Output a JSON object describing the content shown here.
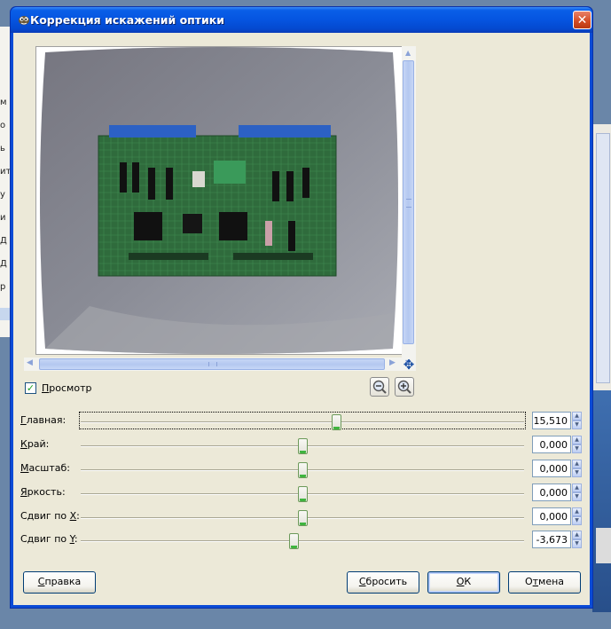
{
  "window": {
    "title": "Коррекция искажений оптики",
    "close_glyph": "✕"
  },
  "background": {
    "left_items": [
      "м",
      "о",
      "ь",
      "ит",
      "у",
      "и",
      "Д",
      "Д",
      "р"
    ]
  },
  "preview": {
    "checkbox_checked": true,
    "checkbox_mark": "✓",
    "checkbox_label_first": "П",
    "checkbox_label_rest": "росмотр",
    "nav_glyph": "✥"
  },
  "sliders": [
    {
      "label_pre": "",
      "label_ul": "Г",
      "label_post": "лавная:",
      "value": "15,510",
      "value_num": 15.51,
      "focused": true
    },
    {
      "label_pre": "",
      "label_ul": "К",
      "label_post": "рай:",
      "value": "0,000",
      "value_num": 0.0
    },
    {
      "label_pre": "",
      "label_ul": "М",
      "label_post": "асштаб:",
      "value": "0,000",
      "value_num": 0.0
    },
    {
      "label_pre": "",
      "label_ul": "Я",
      "label_post": "ркость:",
      "value": "0,000",
      "value_num": 0.0
    },
    {
      "label_pre": "Сдвиг по ",
      "label_ul": "X",
      "label_post": ":",
      "value": "0,000",
      "value_num": 0.0
    },
    {
      "label_pre": "Сдвиг по ",
      "label_ul": "Y",
      "label_post": ":",
      "value": "-3,673",
      "value_num": -3.673
    }
  ],
  "slider_range": [
    -100,
    100
  ],
  "spin_up": "▲",
  "spin_down": "▼",
  "buttons": {
    "help": {
      "ul": "С",
      "rest": "правка"
    },
    "reset": {
      "ul": "С",
      "rest": "бросить"
    },
    "ok": {
      "ul": "О",
      "rest": "К"
    },
    "cancel": {
      "pre": "О",
      "ul": "т",
      "rest": "мена"
    }
  },
  "colors": {
    "titlebar": "#0554e0",
    "dialog_bg": "#ece9d8",
    "slider_accent": "#3fb43f"
  }
}
